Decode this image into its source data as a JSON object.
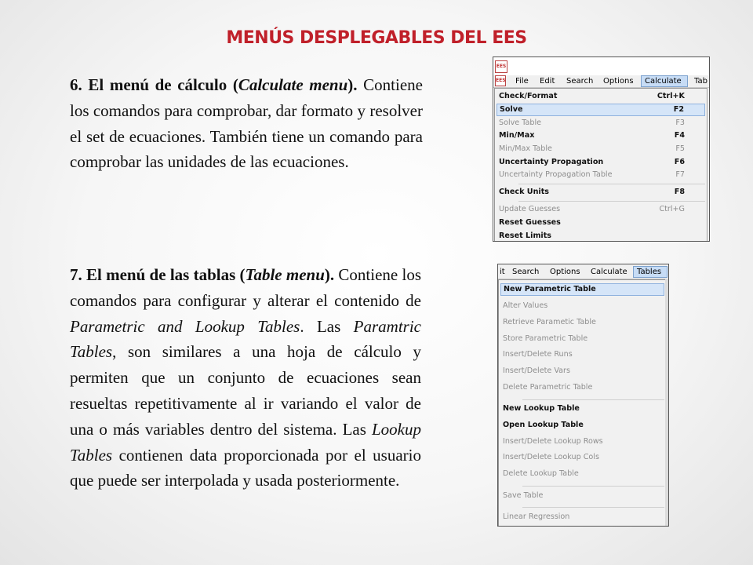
{
  "title": "MENÚS DESPLEGABLES DEL EES",
  "para6": {
    "bold_start": "6. El menú de cálculo (",
    "bold_italic": "Calculate menu",
    "bold_end": ").",
    "body": " Contiene  los comandos para comprobar, dar formato y  resolver el set de ecuaciones. También tiene un  comando para comprobar las unidades de las ecuaciones."
  },
  "para7": {
    "bold_start": "7. El menú de las tablas (",
    "bold_italic": "Table menu",
    "bold_end": ").",
    "t1": " Contiene  los comandos para configurar y alterar el contenido  de ",
    "i1": "Parametric and Lookup Tables",
    "t2": ". Las ",
    "i2": "Paramtric  Tables",
    "t3": ", son similares a una hoja de cálculo y permiten que un conjunto de ecuaciones sean  resueltas repetitivamente al ir variando el valor de  una o más variables dentro del sistema. Las ",
    "i3": "Lookup  Tables",
    "t4": " contienen data proporcionada por el usuario  que puede ser interpolada y usada posteriormente."
  },
  "shot1": {
    "icon_text": "EES",
    "menubar": [
      "File",
      "Edit",
      "Search",
      "Options",
      "Calculate",
      "Tab"
    ],
    "items": [
      {
        "label": "Check/Format",
        "shortcut": "Ctrl+K",
        "state": "bold"
      },
      {
        "label": "Solve",
        "shortcut": "F2",
        "state": "highlight"
      },
      {
        "label": "Solve Table",
        "shortcut": "F3",
        "state": "disabled"
      },
      {
        "label": "Min/Max",
        "shortcut": "F4",
        "state": "bold"
      },
      {
        "label": "Min/Max Table",
        "shortcut": "F5",
        "state": "disabled"
      },
      {
        "label": "Uncertainty Propagation",
        "shortcut": "F6",
        "state": "bold"
      },
      {
        "label": "Uncertainty Propagation Table",
        "shortcut": "F7",
        "state": "disabled"
      },
      {
        "label": "Check Units",
        "shortcut": "F8",
        "state": "bold"
      },
      {
        "label": "Update Guesses",
        "shortcut": "Ctrl+G",
        "state": "disabled"
      },
      {
        "label": "Reset Guesses",
        "shortcut": "",
        "state": "bold"
      },
      {
        "label": "Reset Limits",
        "shortcut": "",
        "state": "bold"
      }
    ]
  },
  "shot2": {
    "menubar": [
      "it",
      "Search",
      "Options",
      "Calculate",
      "Tables"
    ],
    "items": [
      {
        "label": "New Parametric Table",
        "state": "highlight"
      },
      {
        "label": "Alter Values",
        "state": "disabled"
      },
      {
        "label": "Retrieve Parametic Table",
        "state": "disabled"
      },
      {
        "label": "Store Parametric Table",
        "state": "disabled"
      },
      {
        "label": "Insert/Delete Runs",
        "state": "disabled"
      },
      {
        "label": "Insert/Delete Vars",
        "state": "disabled"
      },
      {
        "label": "Delete Parametric Table",
        "state": "disabled"
      },
      {
        "label": "New Lookup Table",
        "state": "bold"
      },
      {
        "label": "Open Lookup Table",
        "state": "bold"
      },
      {
        "label": "Insert/Delete Lookup Rows",
        "state": "disabled"
      },
      {
        "label": "Insert/Delete Lookup Cols",
        "state": "disabled"
      },
      {
        "label": "Delete Lookup Table",
        "state": "disabled"
      },
      {
        "label": "Save Table",
        "state": "disabled"
      },
      {
        "label": "Linear Regression",
        "state": "disabled"
      }
    ]
  }
}
